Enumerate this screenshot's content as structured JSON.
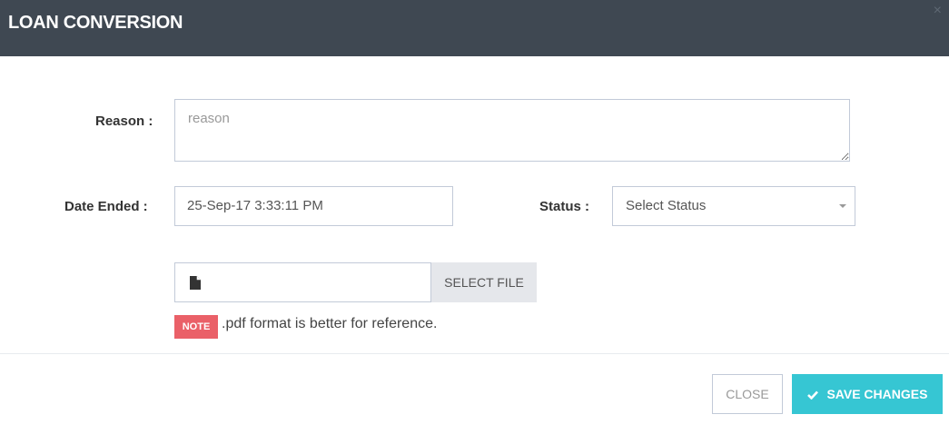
{
  "modal": {
    "title": "LOAN CONVERSION",
    "close_glyph": "×"
  },
  "form": {
    "reason_label": "Reason :",
    "reason_placeholder": "reason",
    "reason_value": "",
    "date_label": "Date Ended :",
    "date_value": "25-Sep-17 3:33:11 PM",
    "status_label": "Status :",
    "status_selected": "Select Status",
    "file_icon": "file-icon",
    "select_file_label": "SELECT FILE",
    "note_badge": "NOTE",
    "note_text": ".pdf format is better for reference."
  },
  "footer": {
    "close_label": "CLOSE",
    "save_label": "SAVE CHANGES",
    "save_icon": "check-icon"
  },
  "colors": {
    "header_bg": "#3f4852",
    "accent": "#36c6d3",
    "note_bg": "#ea6068"
  }
}
